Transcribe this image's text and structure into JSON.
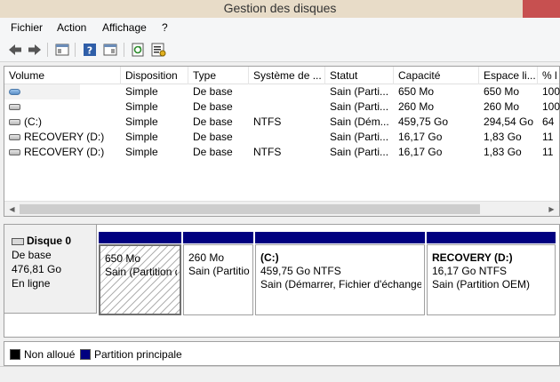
{
  "window": {
    "title": "Gestion des disques"
  },
  "menu": [
    "Fichier",
    "Action",
    "Affichage",
    "?"
  ],
  "columns": [
    "Volume",
    "Disposition",
    "Type",
    "Système de ...",
    "Statut",
    "Capacité",
    "Espace li...",
    "% l"
  ],
  "volumes": [
    {
      "name": "",
      "icon": "blue-volume-icon",
      "disposition": "Simple",
      "type": "De base",
      "fs": "",
      "status": "Sain (Parti...",
      "capacity": "650 Mo",
      "free": "650 Mo",
      "pct": "100"
    },
    {
      "name": "",
      "icon": "volume-icon",
      "disposition": "Simple",
      "type": "De base",
      "fs": "",
      "status": "Sain (Parti...",
      "capacity": "260 Mo",
      "free": "260 Mo",
      "pct": "100"
    },
    {
      "name": "(C:)",
      "icon": "volume-icon",
      "disposition": "Simple",
      "type": "De base",
      "fs": "NTFS",
      "status": "Sain (Dém...",
      "capacity": "459,75 Go",
      "free": "294,54 Go",
      "pct": "64"
    },
    {
      "name": "RECOVERY (D:)",
      "icon": "volume-icon",
      "disposition": "Simple",
      "type": "De base",
      "fs": "",
      "status": "Sain (Parti...",
      "capacity": "16,17 Go",
      "free": "1,83 Go",
      "pct": "11"
    },
    {
      "name": "RECOVERY (D:)",
      "icon": "volume-icon",
      "disposition": "Simple",
      "type": "De base",
      "fs": "NTFS",
      "status": "Sain (Parti...",
      "capacity": "16,17 Go",
      "free": "1,83 Go",
      "pct": "11"
    }
  ],
  "disk": {
    "name": "Disque 0",
    "type": "De base",
    "size": "476,81 Go",
    "state": "En ligne"
  },
  "partitions": [
    {
      "name": "",
      "size": "650 Mo",
      "status": "Sain (Partition d"
    },
    {
      "name": "",
      "size": "260 Mo",
      "status": "Sain (Partitio"
    },
    {
      "name": "(C:)",
      "size": "459,75 Go NTFS",
      "status": "Sain (Démarrer, Fichier d'échange"
    },
    {
      "name": "RECOVERY  (D:)",
      "size": "16,17 Go NTFS",
      "status": "Sain (Partition OEM)"
    }
  ],
  "legend": [
    {
      "label": "Non alloué",
      "color": "#000000"
    },
    {
      "label": "Partition principale",
      "color": "#000080"
    }
  ]
}
